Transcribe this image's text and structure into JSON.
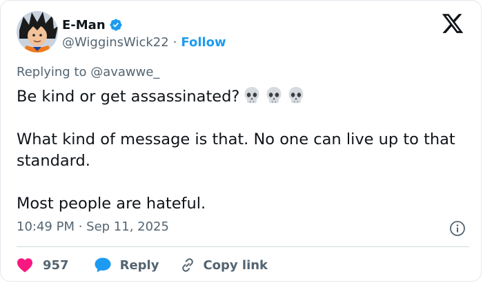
{
  "author": {
    "display_name": "E-Man",
    "handle": "@WigginsWick22",
    "separator": "·",
    "follow_label": "Follow"
  },
  "replying": {
    "prefix": "Replying to ",
    "target": "@avawwe_"
  },
  "tweet": {
    "line1": "Be kind or get assassinated?",
    "emoji_names": [
      "skull-emoji",
      "skull-emoji",
      "skull-emoji"
    ],
    "paragraph2": "What kind of message is that. No one can live up to that standard.",
    "paragraph3": "Most people are hateful."
  },
  "meta": {
    "timestamp": "10:49 PM · Sep 11, 2025"
  },
  "actions": {
    "like_count": "957",
    "reply_label": "Reply",
    "copy_label": "Copy link"
  },
  "colors": {
    "accent": "#1d9bf0",
    "like": "#f91880",
    "text": "#0f1419",
    "muted": "#536471"
  },
  "icons": [
    "avatar",
    "verified-badge-icon",
    "x-logo-icon",
    "info-icon",
    "heart-icon",
    "reply-bubble-icon",
    "link-icon"
  ]
}
